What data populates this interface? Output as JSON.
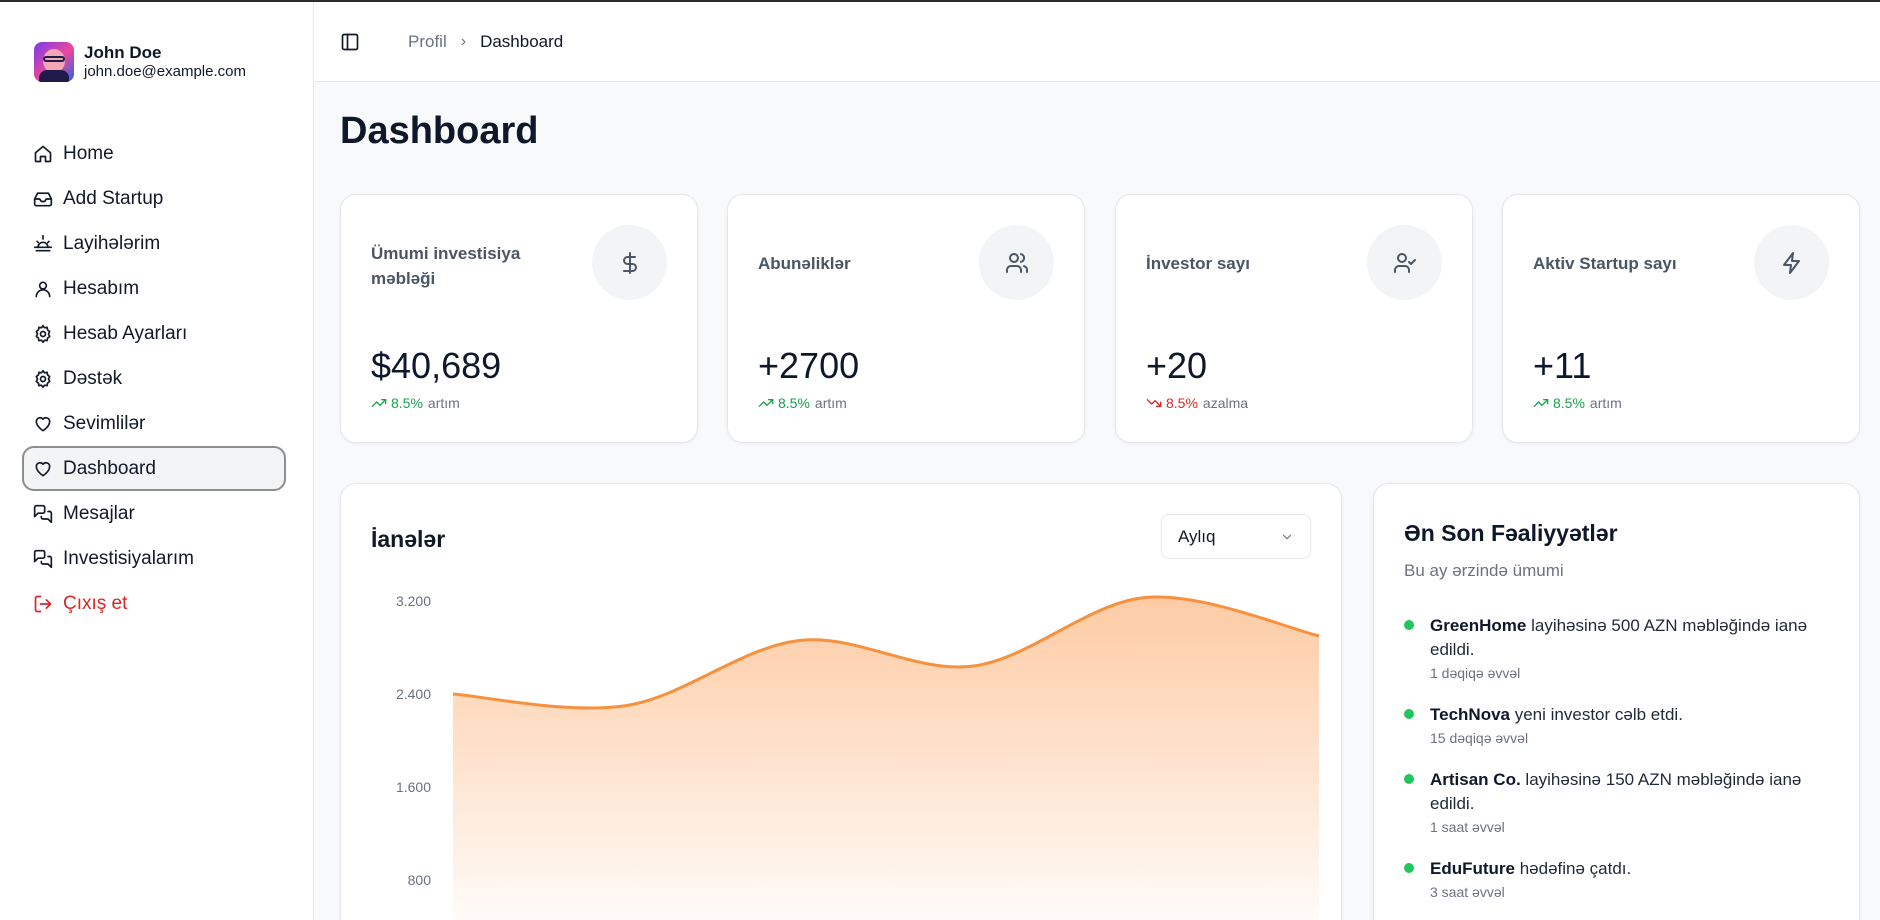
{
  "user": {
    "name": "John Doe",
    "email": "john.doe@example.com"
  },
  "sidebar": {
    "items": [
      {
        "label": "Home",
        "icon": "home-icon"
      },
      {
        "label": "Add Startup",
        "icon": "inbox-icon"
      },
      {
        "label": "Layihələrim",
        "icon": "sunrise-icon"
      },
      {
        "label": "Hesabım",
        "icon": "user-icon"
      },
      {
        "label": "Hesab Ayarları",
        "icon": "gear-icon"
      },
      {
        "label": "Dəstək",
        "icon": "gear-icon"
      },
      {
        "label": "Sevimlilər",
        "icon": "heart-icon"
      },
      {
        "label": "Dashboard",
        "icon": "heart-icon",
        "active": true
      },
      {
        "label": "Mesajlar",
        "icon": "chat-icon"
      },
      {
        "label": "Investisiyalarım",
        "icon": "chat-icon"
      },
      {
        "label": "Çıxış et",
        "icon": "logout-icon"
      }
    ]
  },
  "breadcrumb": {
    "parent": "Profil",
    "current": "Dashboard"
  },
  "page": {
    "title": "Dashboard"
  },
  "stats": [
    {
      "label": "Ümumi investisiya məbləği",
      "value": "$40,689",
      "pct": "8.5%",
      "note": "artım",
      "direction": "up",
      "icon": "dollar-icon"
    },
    {
      "label": "Abunəliklər",
      "value": "+2700",
      "pct": "8.5%",
      "note": "artım",
      "direction": "up",
      "icon": "users-icon"
    },
    {
      "label": "İnvestor sayı",
      "value": "+20",
      "pct": "8.5%",
      "note": "azalma",
      "direction": "down",
      "icon": "user-check-icon"
    },
    {
      "label": "Aktiv Startup sayı",
      "value": "+11",
      "pct": "8.5%",
      "note": "artım",
      "direction": "up",
      "icon": "bolt-icon"
    }
  ],
  "chart_card": {
    "title": "İanələr",
    "period": "Aylıq"
  },
  "chart_data": {
    "type": "area",
    "ylim": [
      0,
      3200
    ],
    "yticks": [
      "3.200",
      "2.400",
      "1.600",
      "800"
    ],
    "ytick_values": [
      3200,
      2400,
      1600,
      800
    ],
    "values": [
      2400,
      2300,
      2860,
      2640,
      3230,
      2900
    ],
    "colors": {
      "line": "#f7913d",
      "fill_top": "#fdc9a0",
      "fill_bottom": "#ffffff"
    }
  },
  "activity": {
    "title": "Ən Son Fəaliyyətlər",
    "subtitle": "Bu ay ərzində ümumi",
    "items": [
      {
        "name": "GreenHome",
        "text": " layihəsinə 500 AZN məbləğində ianə edildi.",
        "time": "1 dəqiqə əvvəl"
      },
      {
        "name": "TechNova",
        "text": " yeni investor cəlb etdi.",
        "time": "15 dəqiqə əvvəl"
      },
      {
        "name": "Artisan Co.",
        "text": " layihəsinə 150 AZN məbləğində ianə edildi.",
        "time": "1 saat əvvəl"
      },
      {
        "name": "EduFuture",
        "text": " hədəfinə çatdı.",
        "time": "3 saat əvvəl"
      }
    ]
  },
  "colors": {
    "accent_up": "#16a34a",
    "accent_down": "#dc2626",
    "active_border": "#8d8d8d",
    "chart_line": "#f7913d"
  }
}
